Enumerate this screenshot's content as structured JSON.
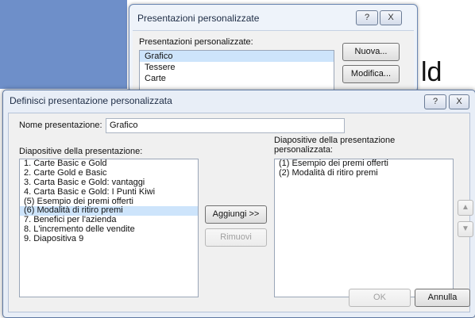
{
  "background": {
    "text_fragment": "ld"
  },
  "back_dialog": {
    "title": "Presentazioni personalizzate",
    "help": "?",
    "close": "X",
    "list_label": "Presentazioni personalizzate:",
    "items": [
      "Grafico",
      "Tessere",
      "Carte"
    ],
    "selected": "Grafico",
    "buttons": {
      "new": "Nuova...",
      "edit": "Modifica..."
    }
  },
  "front_dialog": {
    "title": "Definisci presentazione personalizzata",
    "help": "?",
    "close": "X",
    "name_label": "Nome presentazione:",
    "name_value": "Grafico",
    "left_label": "Diapositive della presentazione:",
    "left_items": [
      "1. Carte Basic e Gold",
      "2. Carte Gold e Basic",
      "3. Carta Basic e Gold: vantaggi",
      "4. Carta Basic e Gold: I Punti Kiwi",
      "(5) Esempio dei premi offerti",
      "(6) Modalità di ritiro premi",
      "7. Benefici per l'azienda",
      "8. L'incremento delle vendite",
      "9. Diapositiva 9"
    ],
    "left_selected_index": 5,
    "right_label_line1": "Diapositive della presentazione",
    "right_label_line2": "personalizzata:",
    "right_items": [
      "(1) Esempio dei premi offerti",
      "(2) Modalità di ritiro premi"
    ],
    "buttons": {
      "add": "Aggiungi >>",
      "remove": "Rimuovi",
      "ok": "OK",
      "cancel": "Annulla"
    },
    "icons": {
      "up": "arrow-up-icon",
      "down": "arrow-down-icon"
    }
  }
}
